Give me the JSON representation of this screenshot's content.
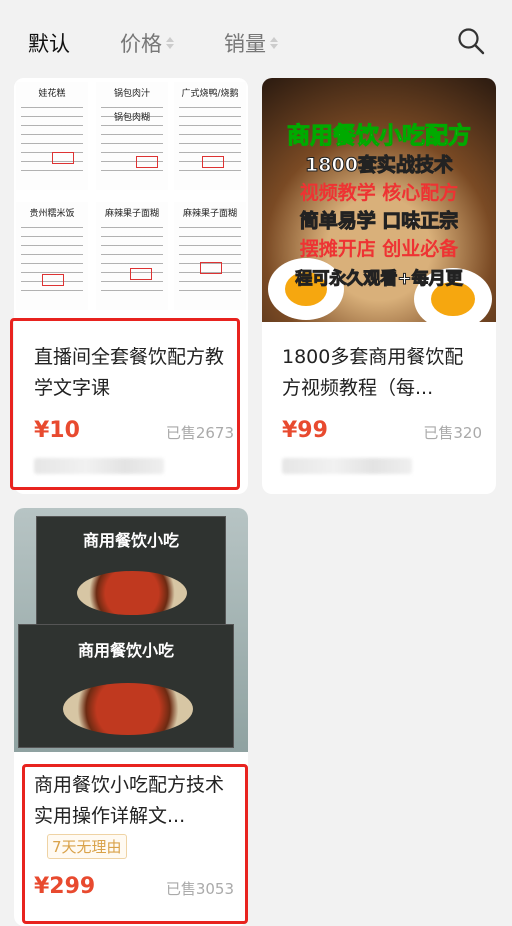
{
  "sort_bar": {
    "tabs": [
      {
        "label": "默认",
        "active": true
      },
      {
        "label": "价格",
        "active": false
      },
      {
        "label": "销量",
        "active": false
      }
    ],
    "search_icon": "search-icon"
  },
  "products": [
    {
      "title": "直播间全套餐饮配方教学文字课",
      "price": "¥10",
      "sold": "已售2673",
      "thumb_sheet_titles": [
        "娃花糕",
        "锅包肉汁",
        "广式烧鸭/烧鹅",
        "锅包肉糊",
        "贵州糯米饭",
        "麻辣果子面糊",
        "麻辣果子面糊"
      ]
    },
    {
      "title": "1800多套商用餐饮配方视频教程（每...",
      "price": "¥99",
      "sold": "已售320",
      "thumb_ad_lines": [
        "商用餐饮小吃配方",
        "1800套实战技术",
        "视频教学 核心配方",
        "简单易学 口味正宗",
        "摆摊开店 创业必备",
        "程可永久观看+每月更"
      ]
    },
    {
      "title": "商用餐饮小吃配方技术实用操作详解文...",
      "badge": "7天无理由",
      "price": "¥299",
      "sold": "已售3053",
      "thumb_book_titles": [
        "商用餐饮小吃",
        "商用餐饮小吃"
      ]
    }
  ],
  "colors": {
    "price": "#e84a2f",
    "highlight": "#e8231f",
    "badge": "#d9a24a"
  }
}
